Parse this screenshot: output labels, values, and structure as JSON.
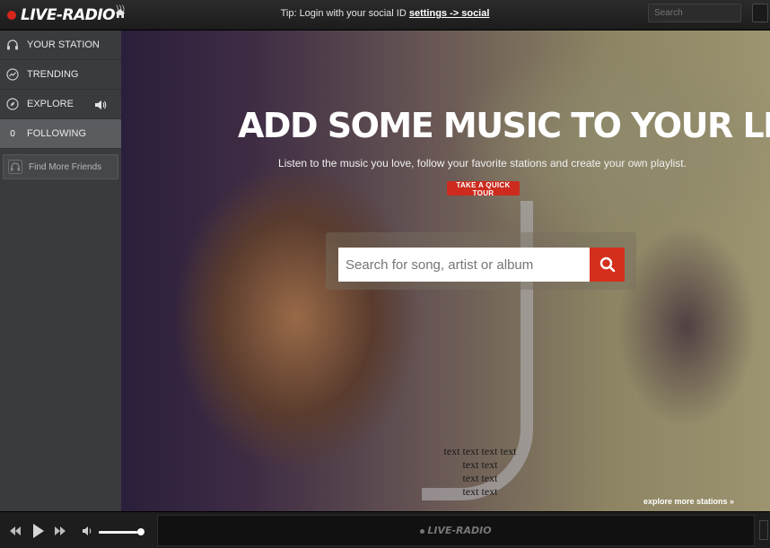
{
  "app": {
    "logo": "LIVE-RADIO",
    "accent_color": "#d42f1c"
  },
  "topbar": {
    "tip_prefix": "Tip: Login with your social ID",
    "tip_link": "settings -> social",
    "search_placeholder": "Search"
  },
  "sidebar": {
    "items": [
      {
        "label": "YOUR STATION",
        "icon": "headphones-icon"
      },
      {
        "label": "TRENDING",
        "icon": "trending-icon"
      },
      {
        "label": "EXPLORE",
        "icon": "compass-icon"
      },
      {
        "label": "FOLLOWING",
        "count": "0",
        "active": true
      }
    ],
    "find_friends": "Find More Friends"
  },
  "hero": {
    "title": "ADD SOME MUSIC TO YOUR LIFE",
    "subtitle": "Listen to the music you love, follow your favorite stations and create your own playlist.",
    "tour_button": "TAKE A QUICK TOUR",
    "search_placeholder": "Search for song, artist or album",
    "placeholder_lines": [
      "text text text text",
      "text text",
      "text text",
      "text text"
    ],
    "explore_more": "explore more stations »"
  },
  "player": {
    "logo": "LIVE-RADIO",
    "volume_fraction": 0.9
  }
}
